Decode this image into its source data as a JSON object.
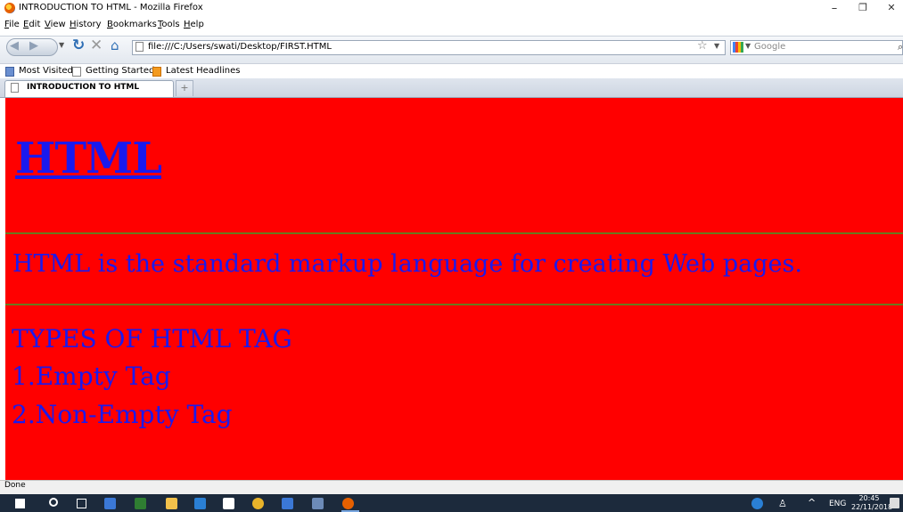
{
  "window": {
    "title": "INTRODUCTION TO HTML - Mozilla Firefox",
    "minimize": "–",
    "maximize": "❐",
    "close": "✕"
  },
  "menu": [
    "File",
    "Edit",
    "View",
    "History",
    "Bookmarks",
    "Tools",
    "Help"
  ],
  "nav": {
    "url": "file:///C:/Users/swati/Desktop/FIRST.HTML",
    "search_placeholder": "Google"
  },
  "bookmarks": [
    {
      "label": "Most Visited",
      "icon": "most-visited-icon"
    },
    {
      "label": "Getting Started",
      "icon": "page-icon"
    },
    {
      "label": "Latest Headlines",
      "icon": "rss-icon"
    }
  ],
  "tab": {
    "label": "INTRODUCTION TO HTML",
    "new_tab": "+"
  },
  "page": {
    "heading": "HTML",
    "paragraph": "HTML is the standard markup language for creating Web pages.",
    "list_title": "TYPES OF HTML TAG",
    "items": [
      "1.Empty Tag",
      "2.Non-Empty Tag"
    ],
    "background": "#ff0000",
    "text_color": "#1a1aee"
  },
  "status": {
    "text": "Done"
  },
  "taskbar": {
    "lang": "ENG",
    "time": "20:45",
    "date": "22/11/2018"
  }
}
